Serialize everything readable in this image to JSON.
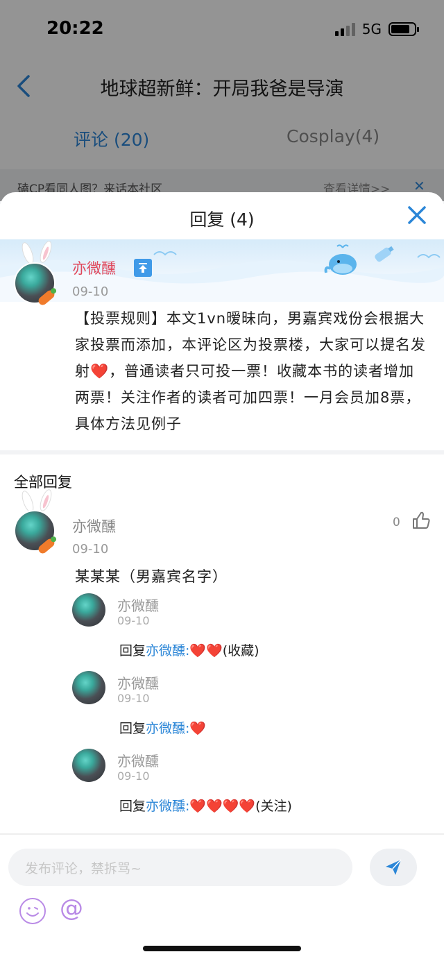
{
  "status_bar": {
    "time": "20:22",
    "network": "5G"
  },
  "nav": {
    "title": "地球超新鲜：开局我爸是导演"
  },
  "tabs": [
    {
      "label": "评论 (20)"
    },
    {
      "label": "Cosplay(4)"
    }
  ],
  "promo": {
    "text": "磕CP看同人图？来话本社区",
    "link": "查看详情>>"
  },
  "sheet": {
    "title": "回复 (4)",
    "main_comment": {
      "author": "亦微醺",
      "date": "09-10",
      "text_before_heart": "【投票规则】本文1vn暧昧向，男嘉宾戏份会根据大家投票而添加，本评论区为投票楼，大家可以提名发射",
      "heart": "❤️",
      "text_after_heart": "，普通读者只可投一票！收藏本书的读者增加两票！关注作者的读者可加四票！一月会员加8票，具体方法见例子"
    },
    "all_replies_label": "全部回复",
    "reply": {
      "author": "亦微醺",
      "date": "09-10",
      "likes": "0",
      "text": "某某某（男嘉宾名字）"
    },
    "sub_replies": [
      {
        "author": "亦微醺",
        "date": "09-10",
        "prefix": "回复",
        "mention": "亦微醺:",
        "hearts": "❤️❤️",
        "suffix": "(收藏)"
      },
      {
        "author": "亦微醺",
        "date": "09-10",
        "prefix": "回复",
        "mention": "亦微醺:",
        "hearts": "❤️",
        "suffix": ""
      },
      {
        "author": "亦微醺",
        "date": "09-10",
        "prefix": "回复",
        "mention": "亦微醺:",
        "hearts": "❤️❤️❤️❤️",
        "suffix": "(关注)"
      }
    ],
    "input": {
      "placeholder": "发布评论，禁拆骂~"
    }
  },
  "colors": {
    "accent": "#2b86d7",
    "author_highlight": "#e0475b",
    "heart": "#e5322f",
    "toolbar_icon": "#b98ae6"
  },
  "icons": [
    "back-arrow-icon",
    "close-icon",
    "pin-top-icon",
    "whale-icon",
    "bottle-icon",
    "thumbs-up-icon",
    "send-icon",
    "emoji-icon",
    "at-icon"
  ]
}
